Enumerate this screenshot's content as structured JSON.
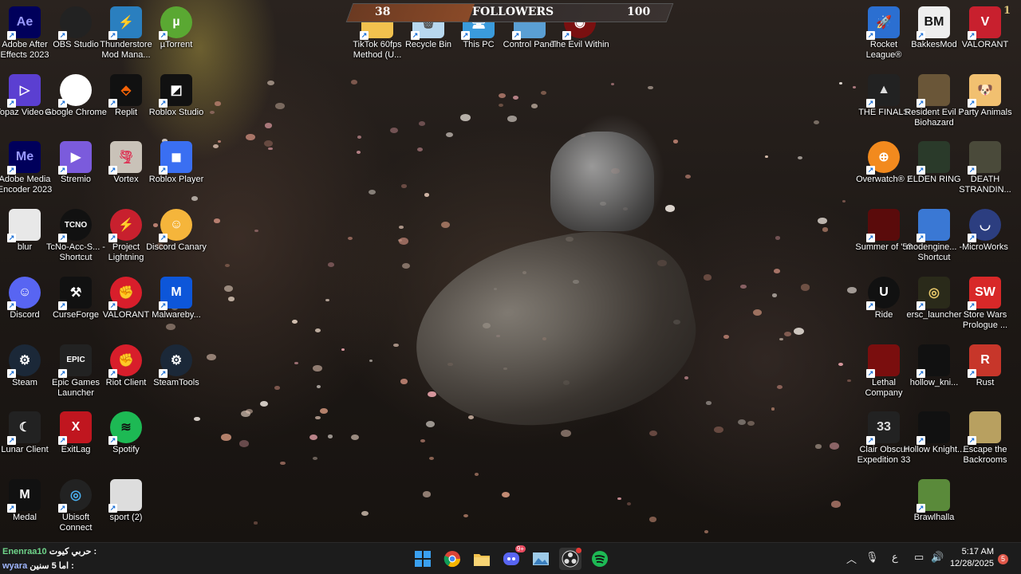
{
  "desktop": {
    "icons": [
      {
        "id": "after-effects",
        "label": "Adobe After Effects 2023",
        "glyph": "Ae"
      },
      {
        "id": "obs-studio",
        "label": "OBS Studio",
        "glyph": ""
      },
      {
        "id": "thunderstore",
        "label": "Thunderstore Mod Mana...",
        "glyph": "⚡"
      },
      {
        "id": "utorrent",
        "label": "µTorrent",
        "glyph": "µ"
      },
      {
        "id": "topaz-video-ai",
        "label": "Topaz Video AI",
        "glyph": "▷"
      },
      {
        "id": "google-chrome",
        "label": "Google Chrome",
        "glyph": ""
      },
      {
        "id": "replit",
        "label": "Replit",
        "glyph": "⬘"
      },
      {
        "id": "roblox-studio",
        "label": "Roblox Studio",
        "glyph": "◩"
      },
      {
        "id": "media-encoder",
        "label": "Adobe Media Encoder 2023",
        "glyph": "Me"
      },
      {
        "id": "stremio",
        "label": "Stremio",
        "glyph": "▶"
      },
      {
        "id": "vortex",
        "label": "Vortex",
        "glyph": "🌪"
      },
      {
        "id": "roblox-player",
        "label": "Roblox Player",
        "glyph": "◼"
      },
      {
        "id": "blur",
        "label": "blur",
        "glyph": ""
      },
      {
        "id": "tcno-acc",
        "label": "TcNo-Acc-S... - Shortcut",
        "glyph": "TCNO"
      },
      {
        "id": "project-lightning",
        "label": "Project Lightning",
        "glyph": "⚡"
      },
      {
        "id": "discord-canary",
        "label": "Discord Canary",
        "glyph": "☺"
      },
      {
        "id": "discord",
        "label": "Discord",
        "glyph": "☺"
      },
      {
        "id": "curseforge",
        "label": "CurseForge",
        "glyph": "⚒"
      },
      {
        "id": "valorant-left",
        "label": "VALORANT",
        "glyph": "✊"
      },
      {
        "id": "malwarebytes",
        "label": "Malwareby...",
        "glyph": "M"
      },
      {
        "id": "steam",
        "label": "Steam",
        "glyph": "⚙"
      },
      {
        "id": "epic-games",
        "label": "Epic Games Launcher",
        "glyph": "EPIC"
      },
      {
        "id": "riot-client",
        "label": "Riot Client",
        "glyph": "✊"
      },
      {
        "id": "steamtools",
        "label": "SteamTools",
        "glyph": "⚙"
      },
      {
        "id": "lunar-client",
        "label": "Lunar Client",
        "glyph": "☾"
      },
      {
        "id": "exitlag",
        "label": "ExitLag",
        "glyph": "X"
      },
      {
        "id": "spotify",
        "label": "Spotify",
        "glyph": "≋"
      },
      {
        "id": "medal",
        "label": "Medal",
        "glyph": "M"
      },
      {
        "id": "ubisoft-connect",
        "label": "Ubisoft Connect",
        "glyph": "◎"
      },
      {
        "id": "sport-2",
        "label": "sport (2)",
        "glyph": ""
      },
      {
        "id": "tiktok-60fps",
        "label": "TikTok 60fps Method (U...",
        "glyph": ""
      },
      {
        "id": "recycle-bin",
        "label": "Recycle Bin",
        "glyph": "🗑"
      },
      {
        "id": "this-pc",
        "label": "This PC",
        "glyph": "🖥"
      },
      {
        "id": "control-panel",
        "label": "Control Panel",
        "glyph": ""
      },
      {
        "id": "the-evil-within",
        "label": "The Evil Within",
        "glyph": "◉"
      },
      {
        "id": "rocket-league",
        "label": "Rocket League®",
        "glyph": "🚀"
      },
      {
        "id": "bakkesmod",
        "label": "BakkesMod",
        "glyph": "BM"
      },
      {
        "id": "valorant-right",
        "label": "VALORANT",
        "glyph": "V"
      },
      {
        "id": "the-finals",
        "label": "THE FINALS",
        "glyph": "▲"
      },
      {
        "id": "resident-evil-7",
        "label": "Resident Evil 7 Biohazard",
        "glyph": ""
      },
      {
        "id": "party-animals",
        "label": "Party Animals",
        "glyph": "🐶"
      },
      {
        "id": "overwatch-2",
        "label": "Overwatch® 2",
        "glyph": "⊕"
      },
      {
        "id": "elden-ring",
        "label": "ELDEN RING",
        "glyph": ""
      },
      {
        "id": "death-stranding",
        "label": "DEATH STRANDIN...",
        "glyph": ""
      },
      {
        "id": "summer-of-58",
        "label": "Summer of '58",
        "glyph": ""
      },
      {
        "id": "modengine",
        "label": "modengine... - Shortcut",
        "glyph": ""
      },
      {
        "id": "microworks",
        "label": "MicroWorks",
        "glyph": "◡"
      },
      {
        "id": "ride",
        "label": "Ride",
        "glyph": "U"
      },
      {
        "id": "ersc-launcher",
        "label": "ersc_launcher",
        "glyph": "◎"
      },
      {
        "id": "store-wars",
        "label": "Store Wars Prologue ...",
        "glyph": "SW"
      },
      {
        "id": "lethal-company",
        "label": "Lethal Company",
        "glyph": ""
      },
      {
        "id": "hollow-knight-1",
        "label": "hollow_kni...",
        "glyph": ""
      },
      {
        "id": "rust",
        "label": "Rust",
        "glyph": "R"
      },
      {
        "id": "clair-obscur",
        "label": "Clair Obscur Expedition 33",
        "glyph": "33"
      },
      {
        "id": "hollow-knight-2",
        "label": "Hollow Knight...",
        "glyph": ""
      },
      {
        "id": "escape-backrooms",
        "label": "Escape the Backrooms",
        "glyph": ""
      },
      {
        "id": "brawlhalla",
        "label": "Brawlhalla",
        "glyph": ""
      }
    ]
  },
  "overlay": {
    "followers_label": "FOLLOWERS",
    "current": "38",
    "goal": "100",
    "progress": 0.38,
    "corner_badge": "1"
  },
  "chat": [
    {
      "user": "Enenraa10",
      "message": "حربي كيوت :"
    },
    {
      "user": "wyara",
      "message": "اما 5 سنين :"
    }
  ],
  "taskbar": {
    "apps": [
      "start-icon",
      "chrome-icon",
      "file-explorer-icon",
      "discord-icon",
      "photos-icon",
      "obs-icon",
      "spotify-icon"
    ],
    "discord_badge": "9+",
    "language": "ع",
    "time": "5:17 AM",
    "date": "12/28/2025",
    "notification_count": "5"
  }
}
